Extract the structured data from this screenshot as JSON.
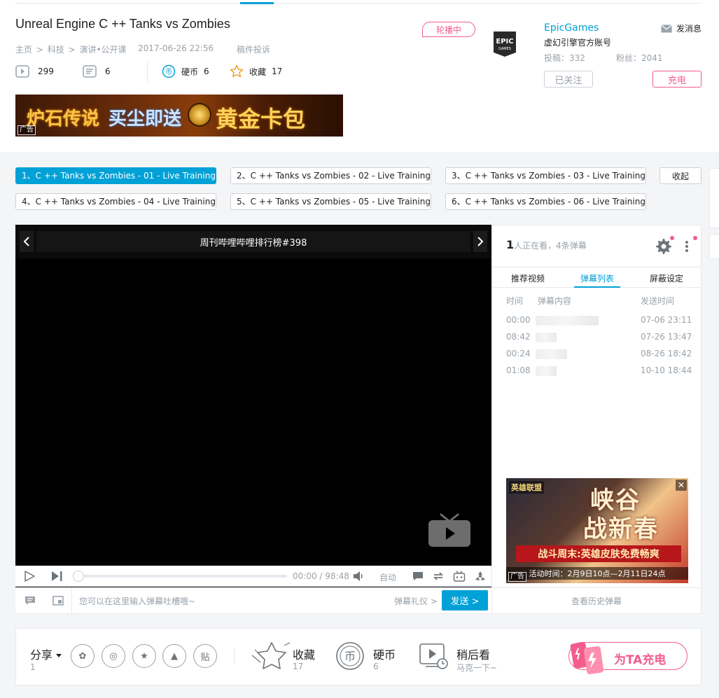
{
  "video": {
    "title": "Unreal Engine C ++ Tanks vs Zombies",
    "breadcrumb": [
      "主页",
      ">",
      "科技",
      ">",
      "演讲•公开课"
    ],
    "date": "2017-06-26 22:56",
    "report": "稿件投诉",
    "plays": "299",
    "danmaku_count": "6",
    "coin_label": "硬币",
    "coins": "6",
    "fav_label": "收藏",
    "favs": "17",
    "carousel_badge": "轮播中"
  },
  "banner_ad": {
    "text1": "炉石传说",
    "text2": "买尘即送",
    "text3": "黄金卡包",
    "ad_tag": "广告"
  },
  "up": {
    "logo_text": "EPIC",
    "logo_sub": "GAMES",
    "name": "EpicGames",
    "message": "发消息",
    "desc": "虚幻引擎官方账号",
    "posts": "投稿：332",
    "fans": "粉丝：2041",
    "followed": "已关注",
    "charge": "充电"
  },
  "parts": [
    "1、C ++ Tanks vs Zombies - 01 - Live Training - ...",
    "2、C ++ Tanks vs Zombies - 02 - Live Training - ...",
    "3、C ++ Tanks vs Zombies - 03 - Live Training - ...",
    "4、C ++ Tanks vs Zombies - 04 - Live Training - ...",
    "5、C ++ Tanks vs Zombies - 05 - Live Training - ...",
    "6、C ++ Tanks vs Zombies - 06 - Live Training - ..."
  ],
  "collapse": "收起",
  "player": {
    "header_title": "周刊哔哩哔哩排行榜#398",
    "current_time": "00:00",
    "time_sep": "/",
    "duration": "98:48",
    "quality": "自动",
    "danmaku_placeholder": "您可以在这里输入弹幕吐槽哦~",
    "danmaku_rite": "弹幕礼仪 >",
    "send": "发送 >",
    "progress_fraction": 0
  },
  "panel": {
    "watching_num": "1",
    "watching_text": "人正在看，4条弹幕",
    "tabs": [
      "推荐视频",
      "弹幕列表",
      "屏蔽设定"
    ],
    "active_tab": 1,
    "col_time": "时间",
    "col_content": "弹幕内容",
    "col_sent": "发送时间",
    "rows": [
      {
        "time": "00:00",
        "sent": "07-06 23:11"
      },
      {
        "time": "08:42",
        "sent": "07-26 13:47"
      },
      {
        "time": "00:24",
        "sent": "08-26 18:42"
      },
      {
        "time": "01:08",
        "sent": "10-10 18:44"
      }
    ],
    "history": "查看历史弹幕"
  },
  "side_ad": {
    "logo": "英雄联盟",
    "line1": "峡谷",
    "line2": "战新春",
    "red_strip": "战斗周末:英雄皮肤免费畅爽",
    "footer": "活动时间：2月9日10点—2月11日24点",
    "ad_tag": "广告",
    "close": "✕"
  },
  "actions": {
    "share": "分享",
    "share_count": "1",
    "fav": "收藏",
    "fav_count": "17",
    "coin": "硬币",
    "coin_count": "6",
    "later": "稍后看",
    "later_sub": "马克一下~",
    "charge_ta": "为TA充电"
  },
  "colors": {
    "accent": "#00a1d6",
    "pink": "#f25d8e",
    "muted": "#99a2aa"
  }
}
